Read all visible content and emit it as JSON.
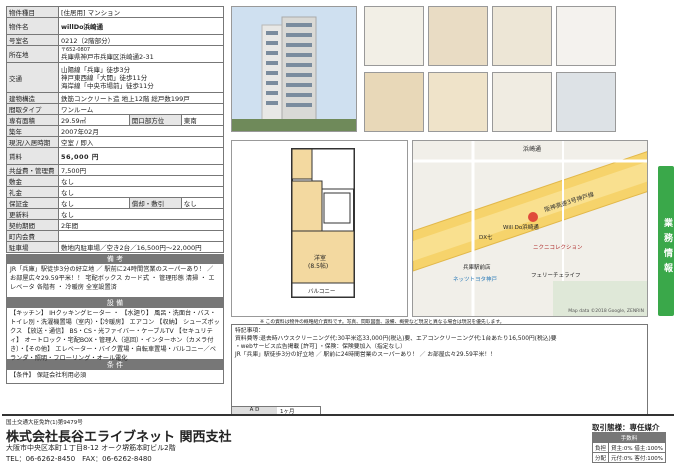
{
  "property": {
    "type_label": "物件種目",
    "type_value": "[住居用] マンション",
    "name_label": "物件名",
    "name_value": "willDo浜崎通",
    "room_label": "号室名",
    "room_value": "0212（2階部分）",
    "location_label": "所在地",
    "postal": "〒652-0807",
    "address": "兵庫県神戸市兵庫区浜崎通2-31",
    "access_label": "交通",
    "access": [
      "山陽線「兵庫」徒歩3分",
      "神戸東西線「大開」徒歩11分",
      "海岸線「中央市場前」徒歩11分"
    ],
    "structure_label": "建物構造",
    "structure_value": "鉄筋コンクリート造 地上12階 総戸数199戸",
    "layout_label": "間取タイプ",
    "layout_value": "ワンルーム",
    "area_label": "専有面積",
    "area_value": "29.59㎡",
    "aspect_label": "開口部方位",
    "aspect_value": "東南",
    "built_label": "築年",
    "built_value": "2007年02月",
    "status_label": "現況/入居時期",
    "status_value": "空室 / 即入",
    "rent_label": "賃料",
    "rent_value": "56,000 円",
    "mgmt_label": "共益費・管理費",
    "mgmt_value": "7,500円",
    "deposit_label": "敷金",
    "deposit_value": "なし",
    "key_label": "礼金",
    "key_value": "なし",
    "guarantee_label": "保証金",
    "guarantee_value": "なし",
    "amort_label": "償却・敷引",
    "amort_value": "なし",
    "renewal_label": "更新料",
    "renewal_value": "なし",
    "contract_label": "契約期間",
    "contract_value": "2年間",
    "assoc_label": "町内会費",
    "assoc_value": "",
    "parking_label": "駐車場",
    "parking_value": "敷地内駐車場／空き2台／16,500円～22,000円"
  },
  "remarks": {
    "title": "備 考",
    "text": "JR「兵庫」駅徒歩3分の好立地 ／ 駅前に24時間営業のスーパーあり！ ／ お部屋広々29.59平米！！ 宅配ボックス カード式 ・ 管理形態 清掃 ・ エレベータ 各階有 ・ 冷暖房 全室設置済"
  },
  "facilities": {
    "title": "設 備",
    "text": "【キッチン】 IHクッキングヒーター ・ 【水廻り】 風呂・洗面台・バス・トイレ別・洗濯機置場（室内）・【冷暖房】 エアコン 【収納】 シューズボックス 【放送・通信】 BS・CS・光ファイバー・ケーブルTV 【セキュリティ】 オートロック・宅配BOX・管理人（巡回）・インターホン（カメラ付き）・【その他】 エレベーター・バイク置場・自転車置場・バルコニー／ベランダ・照明・フローリング・オール電化"
  },
  "conditions": {
    "title": "条 件",
    "text": "【条件】 保証会社利用必須"
  },
  "floorplan": {
    "room_label": "洋室",
    "room_size": "(8.5帖)",
    "balcony_label": "バルコニー"
  },
  "map": {
    "copyright": "Map data ©2018 Google, ZENRIN",
    "labels": [
      "浜崎通",
      "阪神高速3号神戸線",
      "兵庫駅前店",
      "ネッツトヨタ神戸",
      "DX七",
      "Will Do浜崎通",
      "ニクニコレクション",
      "フェリーチェライフ"
    ]
  },
  "notes": {
    "label": "特記事項：",
    "lines": [
      "資料費等:退去時ハウスクリーニング代:30平米迄33,000円(税込)要、エアコンクリーニング代:1台あたり16,500円(税込)要",
      "・webサービス広告掲載 [許可] ・保険：保険要加入（指定なし）",
      "JR「兵庫」駅徒歩3分の好立地 ／ 駅前に24時間営業のスーパーあり！ ／ お部屋広々29.59平米！！"
    ],
    "caption": "※ この資料は物件の概略紹介資料です。写真、間取図面、設備、概要など現況と異なる場合は現況を優先します。",
    "ad_label": "A D",
    "ad_value": "1ヶ月"
  },
  "company": {
    "license": "国土交通大臣免許(1)第9479号",
    "name": "株式会社長谷エライブネット 関西支社",
    "address": "大阪市中央区本町１丁目8-12 オーク堺筋本町ビル2階",
    "tel": "TEL：06-6262-8450　FAX：06-6262-8480",
    "broker_label": "取引態様：専任媒介",
    "fee_title": "手数料",
    "fee_rows": [
      {
        "label": "負担",
        "value": "貸主:0% 借主:100%"
      },
      {
        "label": "分配",
        "value": "元付:0% 客付:100%"
      }
    ]
  },
  "side_tab": "業務情報"
}
